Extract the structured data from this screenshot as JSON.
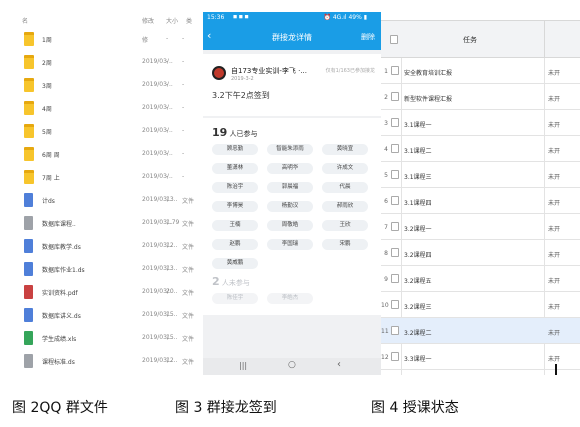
{
  "panel1": {
    "header": {
      "col_name": "名",
      "col_date": "修改",
      "col_size": "大小",
      "col_type": "类"
    },
    "files": [
      {
        "icon": "folder-icon",
        "kind": "folder",
        "name": "1周",
        "date": "修",
        "size": "-",
        "type": "-"
      },
      {
        "icon": "folder-icon",
        "kind": "folder",
        "name": "2周",
        "date": "2019/03/..",
        "size": "-",
        "type": "-"
      },
      {
        "icon": "folder-icon",
        "kind": "folder",
        "name": "3周",
        "date": "2019/03/..",
        "size": "-",
        "type": "-"
      },
      {
        "icon": "folder-icon",
        "kind": "folder",
        "name": "4周",
        "date": "2019/03/..",
        "size": "-",
        "type": "-"
      },
      {
        "icon": "folder-icon",
        "kind": "folder",
        "name": "5周",
        "date": "2019/03/..",
        "size": "-",
        "type": "-"
      },
      {
        "icon": "folder-icon",
        "kind": "folder",
        "name": "6周 周",
        "date": "2019/03/..",
        "size": "-",
        "type": "-"
      },
      {
        "icon": "folder-icon",
        "kind": "folder",
        "name": "7周 上",
        "date": "2019/03/..",
        "size": "-",
        "type": "-"
      },
      {
        "icon": "doc-icon",
        "kind": "doc",
        "name": "计ds",
        "date": "2019/03/..",
        "size": "13..",
        "type": "文件"
      },
      {
        "icon": "file-icon",
        "kind": "file",
        "name": "数据库课程..",
        "date": "2019/03/..",
        "size": "1.79",
        "type": "文件"
      },
      {
        "icon": "doc-icon",
        "kind": "doc",
        "name": "数据库教学.ds",
        "date": "2019/03/..",
        "size": "12..",
        "type": "文件"
      },
      {
        "icon": "doc-icon",
        "kind": "doc",
        "name": "数据库作业1.ds",
        "date": "2019/03/..",
        "size": "13..",
        "type": "文件"
      },
      {
        "icon": "pdf-icon",
        "kind": "pdf",
        "name": "实训资料.pdf",
        "date": "2019/03/..",
        "size": "20..",
        "type": "文件"
      },
      {
        "icon": "doc-icon",
        "kind": "doc",
        "name": "数据库讲义.ds",
        "date": "2019/03/..",
        "size": "15..",
        "type": "文件"
      },
      {
        "icon": "sheet-icon",
        "kind": "sheet",
        "name": "学生成绩.xls",
        "date": "2019/03/..",
        "size": "15..",
        "type": "文件"
      },
      {
        "icon": "file-icon",
        "kind": "file",
        "name": "课程标准.ds",
        "date": "2019/03/..",
        "size": "12..",
        "type": "文件"
      }
    ]
  },
  "panel2": {
    "status_bar": {
      "time": "15:36",
      "indicators": "◼ ◼ ◼",
      "network": "⏰ 4G.ıl 49% ▮"
    },
    "nav": {
      "back_glyph": "‹",
      "title": "群接龙详情",
      "delete_label": "删除"
    },
    "post": {
      "author": "自173专业实训-李飞 ·...",
      "date": "2019-3-2",
      "meta": "仅有1/163已参加接龙",
      "subject": "3.2下午2点签到"
    },
    "participants": {
      "count": "19",
      "count_label": "人已参与",
      "names": [
        "顾忠勤",
        "智能朱添雨",
        "黄晓宣",
        "董潇林",
        "高明华",
        "许成文",
        "陈治宇",
        "郭晨福",
        "代晨",
        "李博昊",
        "杨勤汉",
        "郝雨欣",
        "王楠",
        "周敬皓",
        "王欣",
        "赵鹏",
        "李国瑞",
        "宋鹏",
        "黄威鹏"
      ]
    },
    "pending": {
      "count": "2",
      "count_label": "人未参与",
      "names": [
        "陈佳宇",
        "李皓杰"
      ]
    },
    "softnav": {
      "recent": "|||",
      "home": "○",
      "back": "‹"
    }
  },
  "panel3": {
    "header": {
      "col_task": "任务"
    },
    "rows": [
      {
        "no": "1",
        "task": "安全教育培训汇报",
        "status": "未开"
      },
      {
        "no": "2",
        "task": "新型软件课程汇报",
        "status": "未开"
      },
      {
        "no": "3",
        "task": "3.1课程一",
        "status": "未开"
      },
      {
        "no": "4",
        "task": "3.1课程二",
        "status": "未开"
      },
      {
        "no": "5",
        "task": "3.1课程三",
        "status": "未开"
      },
      {
        "no": "6",
        "task": "3.1课程四",
        "status": "未开"
      },
      {
        "no": "7",
        "task": "3.2课程一",
        "status": "未开"
      },
      {
        "no": "8",
        "task": "3.2课程四",
        "status": "未开"
      },
      {
        "no": "9",
        "task": "3.2课程五",
        "status": "未开"
      },
      {
        "no": "10",
        "task": "3.2课程三",
        "status": "未开"
      },
      {
        "no": "11",
        "task": "3.2课程二",
        "status": "未开",
        "selected": true
      },
      {
        "no": "12",
        "task": "3.3课程一",
        "status": "未开"
      }
    ]
  },
  "captions": {
    "fig2": "图 2QQ 群文件",
    "fig3": "图 3  群接龙签到",
    "fig4": "图 4  授课状态"
  }
}
